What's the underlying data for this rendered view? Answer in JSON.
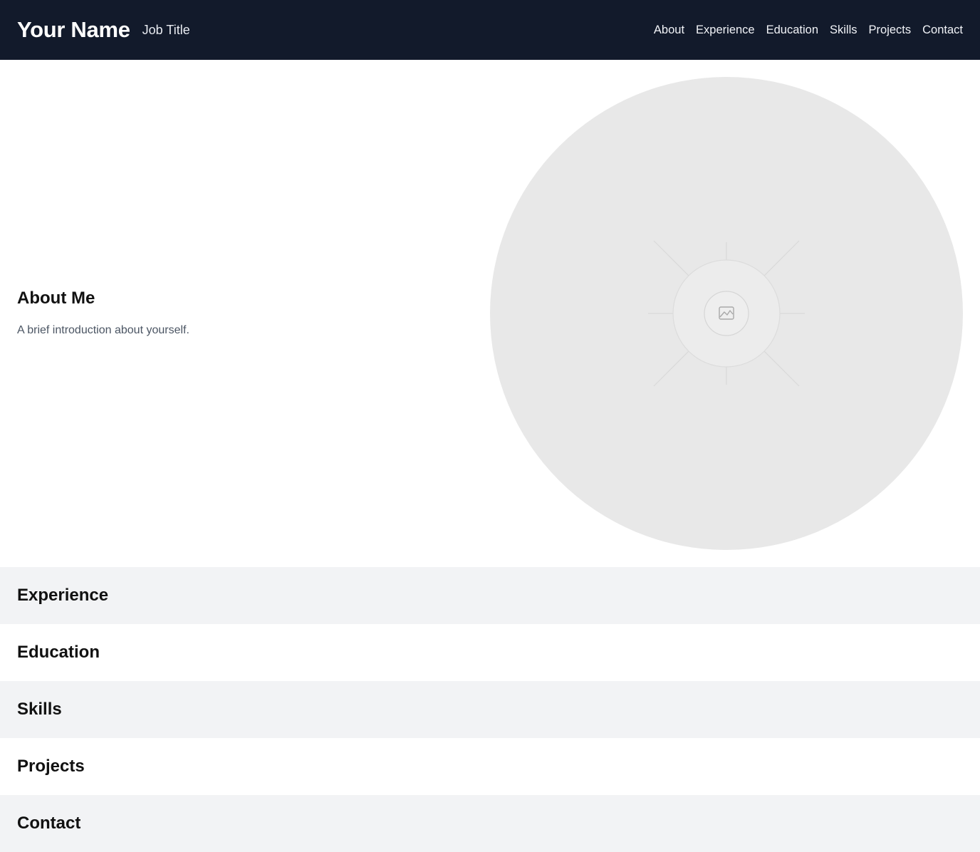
{
  "header": {
    "name": "Your Name",
    "job_title": "Job Title",
    "nav": [
      "About",
      "Experience",
      "Education",
      "Skills",
      "Projects",
      "Contact"
    ]
  },
  "about": {
    "heading": "About Me",
    "text": "A brief introduction about yourself.",
    "photo_icon": "image-placeholder-icon"
  },
  "sections": {
    "experience": "Experience",
    "education": "Education",
    "skills": "Skills",
    "projects": "Projects",
    "contact": "Contact"
  },
  "colors": {
    "header_bg": "#121a2b",
    "section_alt_bg": "#f2f3f5",
    "photo_placeholder": "#e8e8e8"
  }
}
